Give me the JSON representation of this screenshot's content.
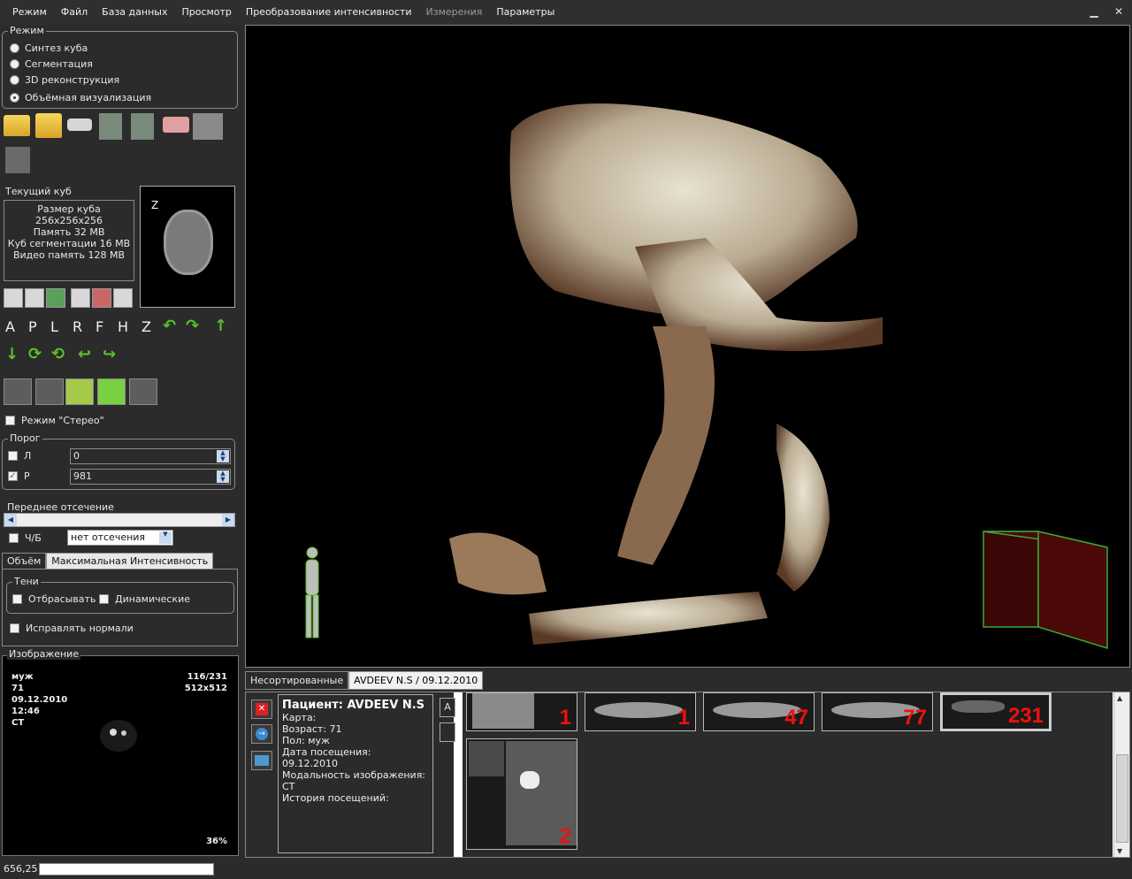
{
  "menu": [
    "Режим",
    "Файл",
    "База данных",
    "Просмотр",
    "Преобразование интенсивности",
    "Измерения",
    "Параметры"
  ],
  "mode": {
    "title": "Режим",
    "options": [
      "Синтез куба",
      "Сегментация",
      "3D реконструкция",
      "Объёмная визуализация"
    ],
    "selected_index": 3
  },
  "cube": {
    "title": "Текущий куб",
    "lines": [
      "Размер куба 256x256x256",
      "Память 32 MB",
      "Куб сегментации 16 MB",
      "Видео память 128 MB"
    ],
    "preview_label": "Z"
  },
  "nav_letters": [
    "A",
    "P",
    "L",
    "R",
    "F",
    "H",
    "Z"
  ],
  "stereo_label": "Режим \"Стерео\"",
  "threshold": {
    "title": "Порог",
    "low_label": "Л",
    "low_value": "0",
    "high_label": "Р",
    "high_value": "981"
  },
  "clipping": {
    "title": "Переднее отсечение",
    "bw_label": "Ч/Б",
    "select_value": "нет отсечения"
  },
  "render_tabs": [
    "Объём",
    "Максимальная Интенсивность"
  ],
  "shadows": {
    "title": "Тени",
    "cast_label": "Отбрасывать",
    "dynamic_label": "Динамические",
    "normals_label": "Исправлять нормали"
  },
  "image": {
    "title": "Изображение",
    "sex": "муж",
    "age": "71",
    "date": "09.12.2010",
    "time": "12:46",
    "modality": "CT",
    "slice": "116/231",
    "size": "512x512",
    "zoom": "36%"
  },
  "browser": {
    "tabs": [
      "Несортированные",
      "AVDEEV N.S / 09.12.2010"
    ],
    "patient_title": "Пациент: AVDEEV N.S",
    "lines": [
      "Карта:",
      "Возраст: 71",
      "Пол: муж",
      "Дата посещения: 09.12.2010",
      "Модальность изображения: CT",
      "История посещений:"
    ],
    "ab": [
      "A",
      ""
    ],
    "thumbs": [
      "1",
      "1",
      "47",
      "77",
      "231",
      "2"
    ]
  },
  "status": {
    "coord": "656,25"
  }
}
